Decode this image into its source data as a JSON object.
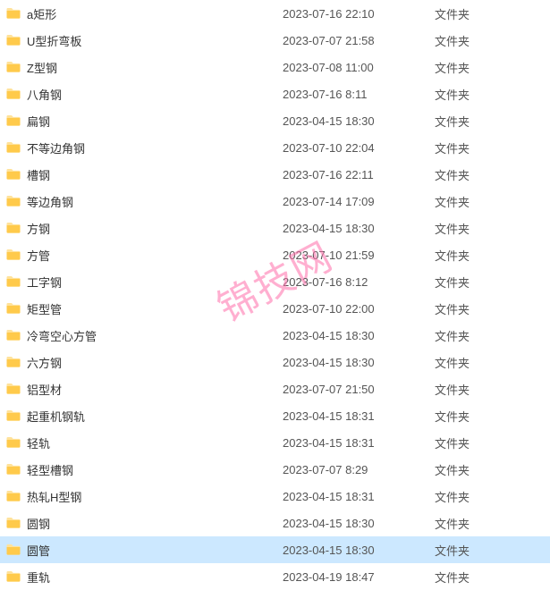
{
  "watermark": "锦技网",
  "files": [
    {
      "name": "a矩形",
      "date": "2023-07-16 22:10",
      "type": "文件夹",
      "selected": false
    },
    {
      "name": "U型折弯板",
      "date": "2023-07-07 21:58",
      "type": "文件夹",
      "selected": false
    },
    {
      "name": "Z型钢",
      "date": "2023-07-08 11:00",
      "type": "文件夹",
      "selected": false
    },
    {
      "name": "八角钢",
      "date": "2023-07-16 8:11",
      "type": "文件夹",
      "selected": false
    },
    {
      "name": "扁钢",
      "date": "2023-04-15 18:30",
      "type": "文件夹",
      "selected": false
    },
    {
      "name": "不等边角钢",
      "date": "2023-07-10 22:04",
      "type": "文件夹",
      "selected": false
    },
    {
      "name": "槽钢",
      "date": "2023-07-16 22:11",
      "type": "文件夹",
      "selected": false
    },
    {
      "name": "等边角钢",
      "date": "2023-07-14 17:09",
      "type": "文件夹",
      "selected": false
    },
    {
      "name": "方钢",
      "date": "2023-04-15 18:30",
      "type": "文件夹",
      "selected": false
    },
    {
      "name": "方管",
      "date": "2023-07-10 21:59",
      "type": "文件夹",
      "selected": false
    },
    {
      "name": "工字钢",
      "date": "2023-07-16 8:12",
      "type": "文件夹",
      "selected": false
    },
    {
      "name": "矩型管",
      "date": "2023-07-10 22:00",
      "type": "文件夹",
      "selected": false
    },
    {
      "name": "冷弯空心方管",
      "date": "2023-04-15 18:30",
      "type": "文件夹",
      "selected": false
    },
    {
      "name": "六方钢",
      "date": "2023-04-15 18:30",
      "type": "文件夹",
      "selected": false
    },
    {
      "name": "铝型材",
      "date": "2023-07-07 21:50",
      "type": "文件夹",
      "selected": false
    },
    {
      "name": "起重机钢轨",
      "date": "2023-04-15 18:31",
      "type": "文件夹",
      "selected": false
    },
    {
      "name": "轻轨",
      "date": "2023-04-15 18:31",
      "type": "文件夹",
      "selected": false
    },
    {
      "name": "轻型槽钢",
      "date": "2023-07-07 8:29",
      "type": "文件夹",
      "selected": false
    },
    {
      "name": "热轧H型钢",
      "date": "2023-04-15 18:31",
      "type": "文件夹",
      "selected": false
    },
    {
      "name": "圆钢",
      "date": "2023-04-15 18:30",
      "type": "文件夹",
      "selected": false
    },
    {
      "name": "圆管",
      "date": "2023-04-15 18:30",
      "type": "文件夹",
      "selected": true
    },
    {
      "name": "重轨",
      "date": "2023-04-19 18:47",
      "type": "文件夹",
      "selected": false
    }
  ]
}
